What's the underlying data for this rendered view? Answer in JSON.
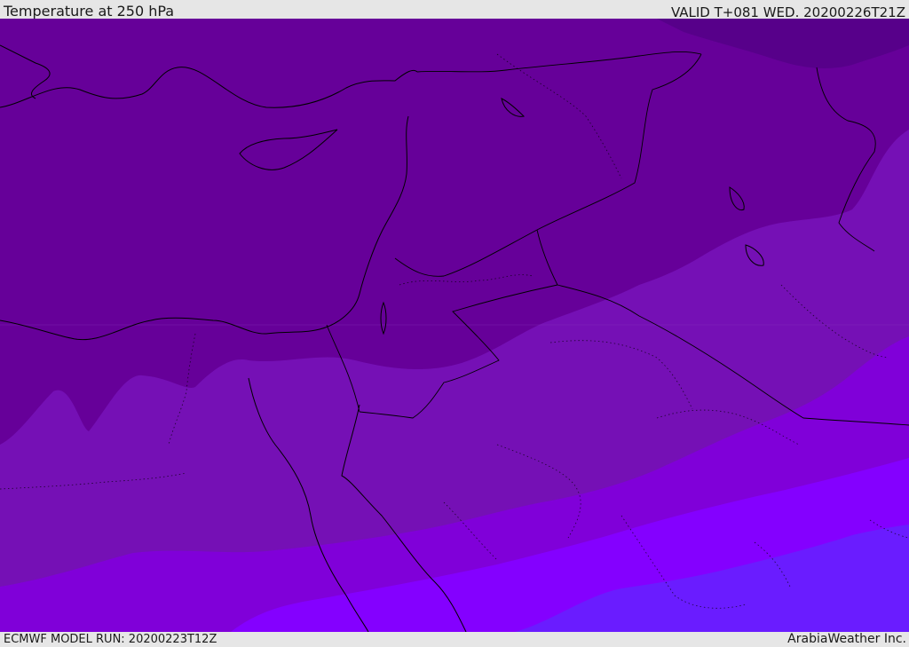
{
  "header": {
    "title": "Temperature at 250 hPa",
    "valid": "VALID T+081 WED. 20200226T21Z"
  },
  "footer": {
    "model_run": "ECMWF MODEL RUN: 20200223T12Z",
    "credit": "ArabiaWeather Inc."
  },
  "map": {
    "region": "Eastern Mediterranean / Levant / Northern Arabia",
    "layer": "temperature-250hPa-shaded",
    "colors": {
      "coldest": "#57008a",
      "band_1": "#660099",
      "band_2": "#7510b5",
      "band_3": "#8000d9",
      "band_4": "#8400ff",
      "warmest": "#6a1cff",
      "coastline": "#000000",
      "borders": "#000000"
    }
  }
}
